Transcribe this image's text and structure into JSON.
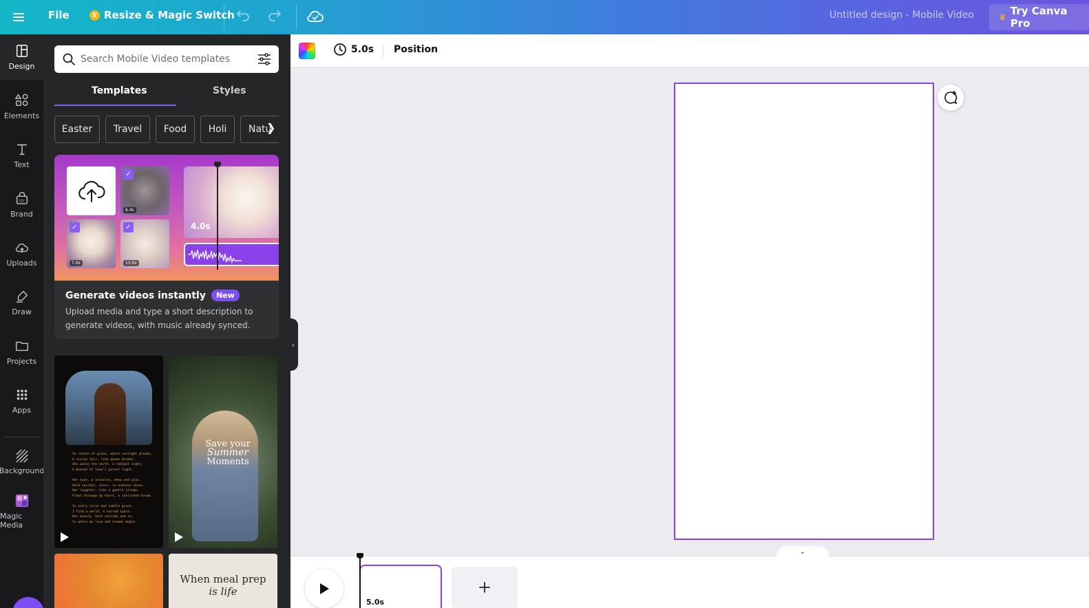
{
  "topbar": {
    "file_label": "File",
    "magic_label": "Resize & Magic Switch",
    "design_title": "Untitled design - Mobile Video",
    "pro_label": "Try Canva Pro",
    "gradient_start": "#13b7c8",
    "gradient_end": "#6a55de"
  },
  "rail": {
    "items": [
      {
        "label": "Design",
        "icon": "layout-icon"
      },
      {
        "label": "Elements",
        "icon": "shapes-icon"
      },
      {
        "label": "Text",
        "icon": "text-icon"
      },
      {
        "label": "Brand",
        "icon": "brand-icon"
      },
      {
        "label": "Uploads",
        "icon": "cloud-upload-icon"
      },
      {
        "label": "Draw",
        "icon": "draw-icon"
      },
      {
        "label": "Projects",
        "icon": "folder-icon"
      },
      {
        "label": "Apps",
        "icon": "grid-icon"
      },
      {
        "label": "Background",
        "icon": "hatch-icon"
      },
      {
        "label": "Magic Media",
        "icon": "magic-media-icon"
      }
    ]
  },
  "panel": {
    "search_placeholder": "Search Mobile Video templates",
    "tabs": [
      "Templates",
      "Styles"
    ],
    "chips": [
      "Easter",
      "Travel",
      "Food",
      "Holi",
      "Natu"
    ],
    "promo": {
      "title": "Generate videos instantly",
      "badge": "New",
      "description": "Upload media and type a short description to generate videos, with music already synced.",
      "durations": [
        "6.4s",
        "7.0s",
        "13.0s"
      ],
      "big_duration": "4.0s"
    },
    "templates": [
      {
        "poem": "In realms of grace, where sunlight gleams,\nA vision fair, like woven dreams.\nShe walks the earth, a radiant sight,\nA beacon of love's purest light.\n\nHer eyes, a universe, deep and wise,\nHold secrets, stars, in endless skies.\nHer laughter, like a gentle stream,\nFlows through my heart, a cherished dream.\n\nIn every curve and subtle grace,\nI find a world, a sacred space.\nHer beauty, both outside and in,\nIs where my love and dreams begin."
      },
      {
        "line1": "Save your",
        "script": "Summer",
        "line3": "Moments"
      },
      {},
      {
        "line1": "When meal prep",
        "line2": "is life"
      }
    ]
  },
  "context_toolbar": {
    "duration": "5.0s",
    "position_label": "Position"
  },
  "canvas": {
    "accent": "#8b3dff"
  },
  "timeline": {
    "clip_duration": "5.0s"
  }
}
